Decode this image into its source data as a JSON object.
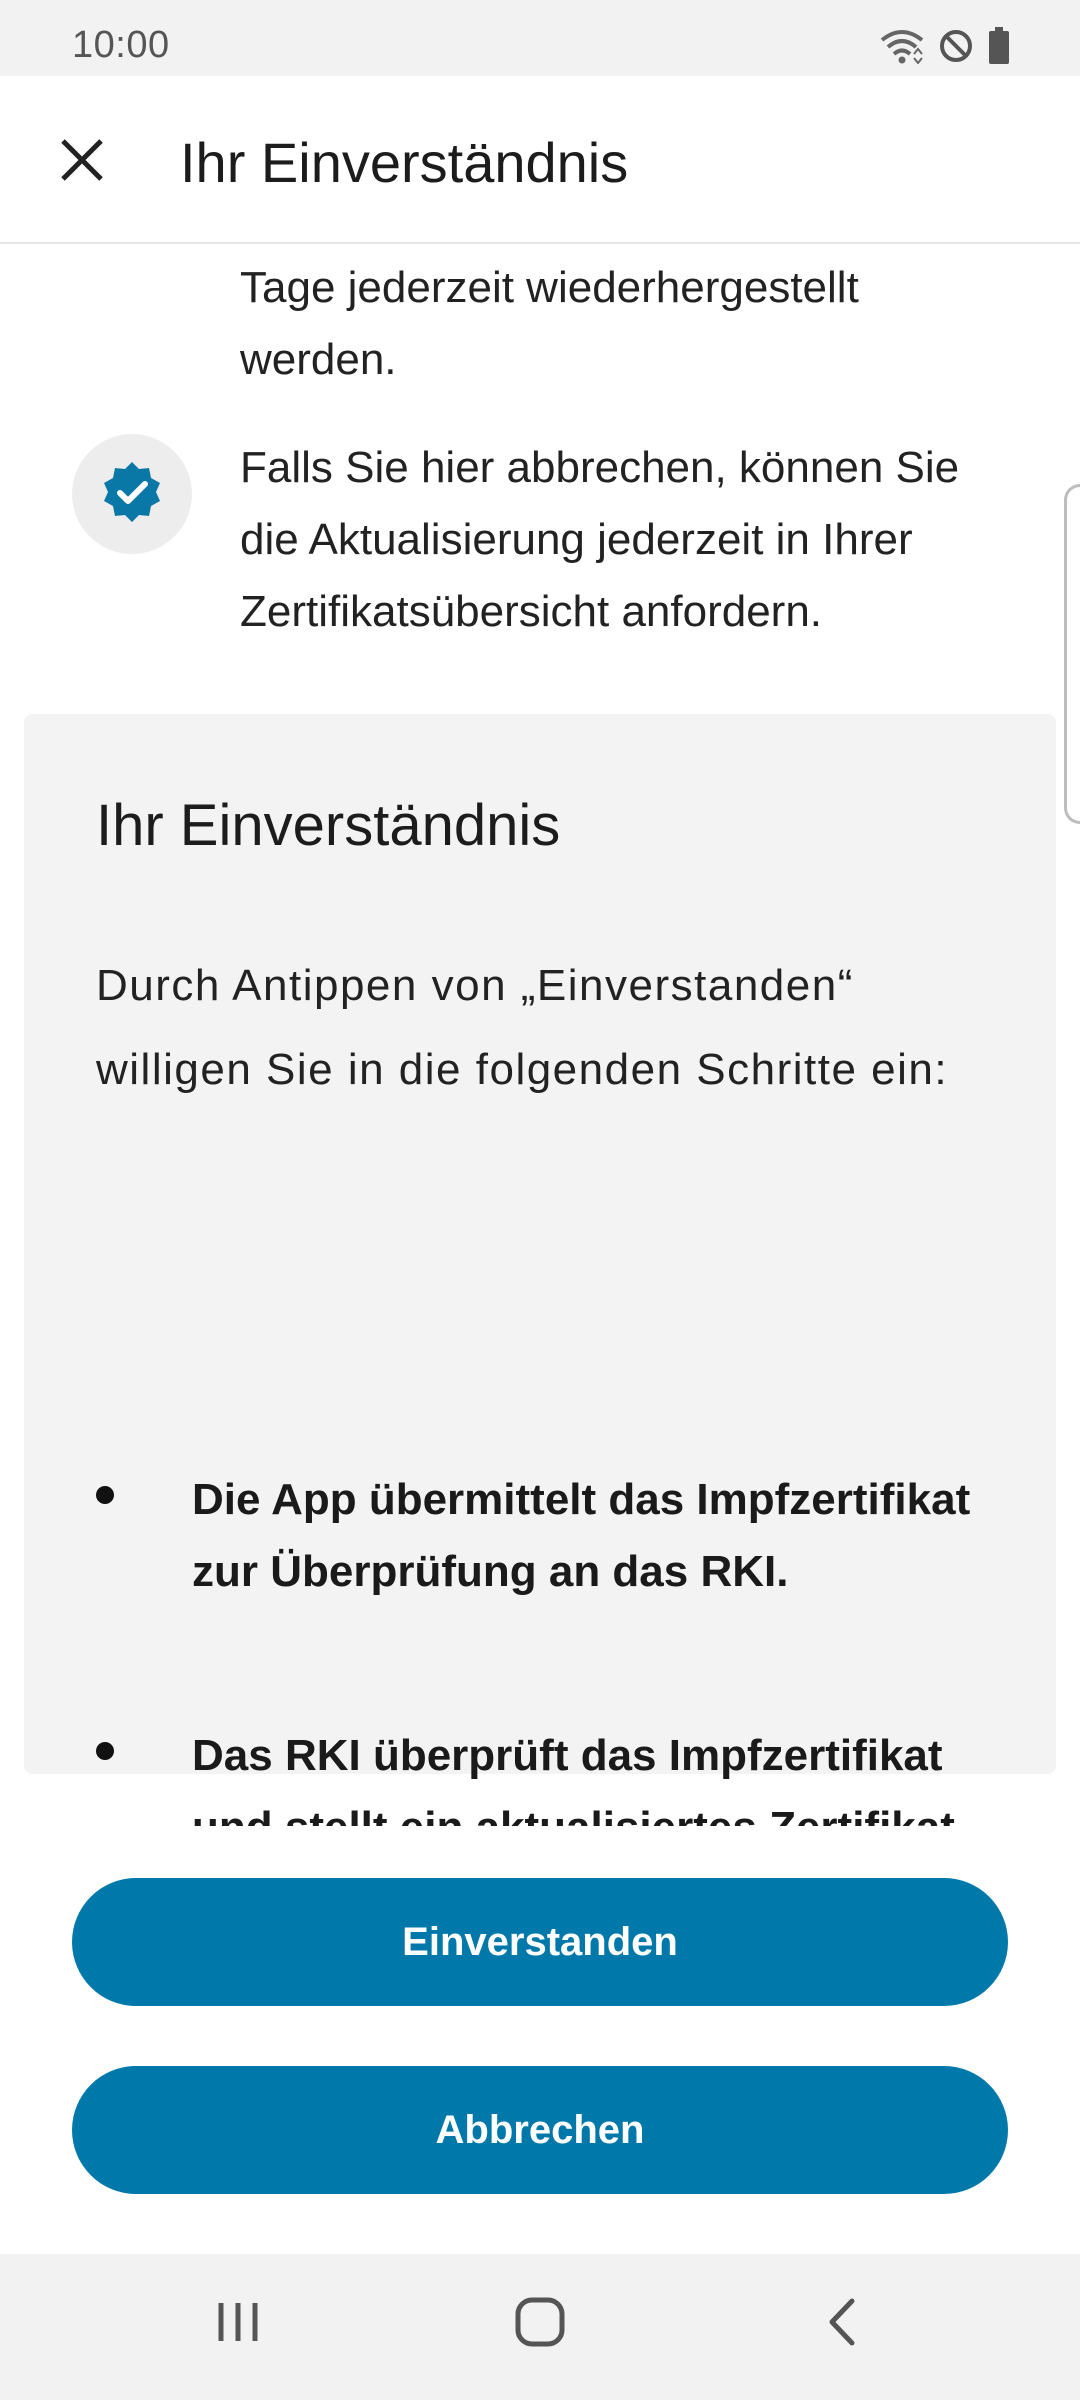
{
  "status_bar": {
    "time": "10:00",
    "icons": [
      "wifi-icon",
      "do-not-disturb-icon",
      "battery-icon"
    ]
  },
  "app_bar": {
    "close_icon": "close-icon",
    "title": "Ihr Einverständnis"
  },
  "content": {
    "para_top": "Tage jederzeit wiederhergestellt werden.",
    "para_cancel": "Falls Sie hier abbrechen, können Sie die Aktualisierung jederzeit in Ihrer Zertifikatsübersicht anfordern.",
    "check_icon": "verified-badge-icon"
  },
  "consent": {
    "heading": "Ihr Einverständnis",
    "intro": "Durch Antippen von „Einverstanden“ willigen Sie in die folgenden Schritte ein:",
    "bullets": [
      "Die App übermittelt das Impfzertifikat zur Überprüfung an das RKI.",
      "Das RKI überprüft das Impfzertifikat und stellt ein aktualisiertes Zertifikat aus und übermittelt dieses an Ihre App."
    ]
  },
  "buttons": {
    "agree_label": "Einverstanden",
    "cancel_label": "Abbrechen"
  },
  "nav_bar": {
    "icons": [
      "recent-apps-icon",
      "home-icon",
      "back-icon"
    ]
  },
  "colors": {
    "accent": "#0079aa",
    "panel": "#f3f3f3"
  }
}
